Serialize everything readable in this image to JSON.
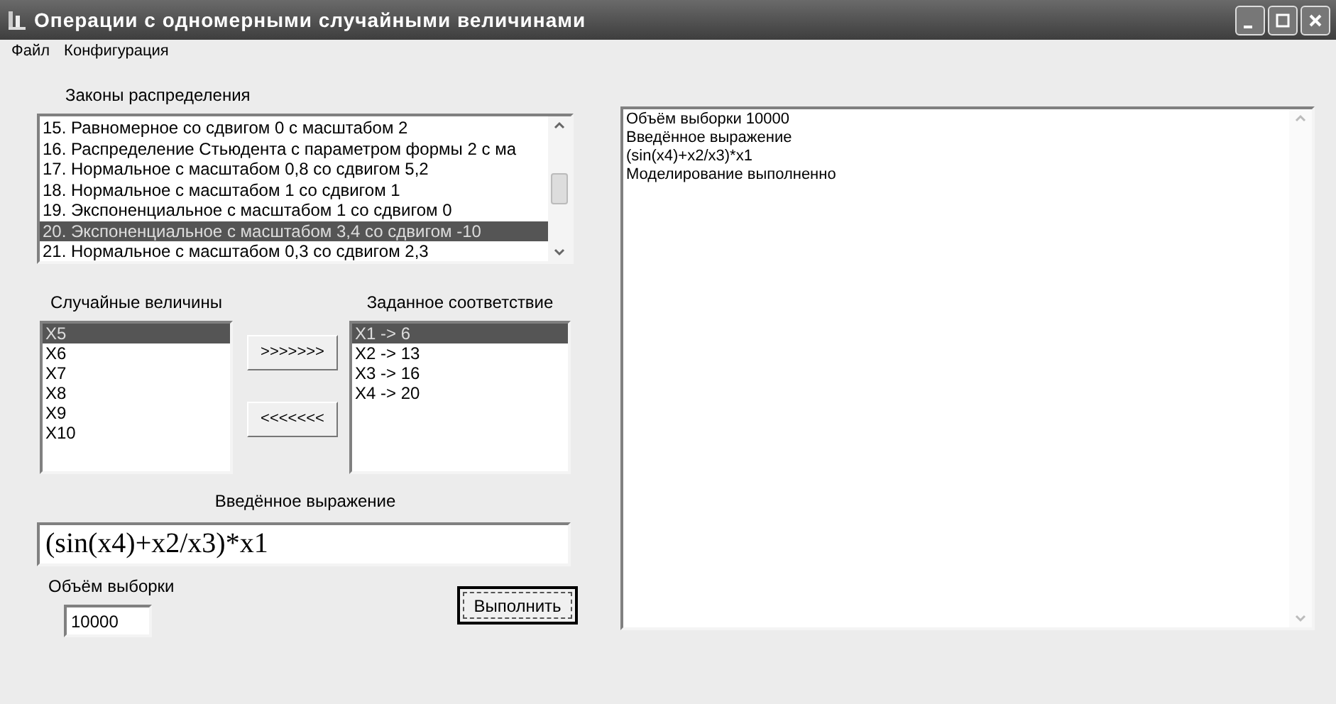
{
  "window": {
    "title": "Операции с одномерными случайными величинами"
  },
  "menu": [
    "Файл",
    "Конфигурация"
  ],
  "distributions": {
    "label": "Законы распределения",
    "items": [
      {
        "text": "15. Равномерное со сдвигом 0 с масштабом 2",
        "selected": false
      },
      {
        "text": "16. Распределение Стьюдента с параметром формы 2 с ма",
        "selected": false
      },
      {
        "text": "17. Нормальное с масштабом 0,8 со сдвигом 5,2",
        "selected": false
      },
      {
        "text": "18. Нормальное с масштабом 1 со сдвигом 1",
        "selected": false
      },
      {
        "text": "19. Экспоненциальное с масштабом 1 со сдвигом 0",
        "selected": false
      },
      {
        "text": "20. Экспоненциальное с масштабом 3,4 со сдвигом -10",
        "selected": true
      },
      {
        "text": "21. Нормальное с масштабом 0,3 со сдвигом 2,3",
        "selected": false
      }
    ]
  },
  "variables": {
    "label": "Случайные величины",
    "items": [
      {
        "text": "X5",
        "selected": true
      },
      {
        "text": "X6",
        "selected": false
      },
      {
        "text": "X7",
        "selected": false
      },
      {
        "text": "X8",
        "selected": false
      },
      {
        "text": "X9",
        "selected": false
      },
      {
        "text": "X10",
        "selected": false
      }
    ]
  },
  "add_button": ">>>>>>>",
  "remove_button": "<<<<<<<",
  "mapping": {
    "label": "Заданное соответствие",
    "items": [
      {
        "text": "X1 -> 6",
        "selected": true
      },
      {
        "text": "X2 -> 13",
        "selected": false
      },
      {
        "text": "X3 -> 16",
        "selected": false
      },
      {
        "text": "X4 -> 20",
        "selected": false
      }
    ]
  },
  "expression": {
    "label": "Введённое выражение",
    "value": "(sin(x4)+x2/x3)*x1"
  },
  "sample_size": {
    "label": "Объём выборки",
    "value": "10000"
  },
  "run_button": "Выполнить",
  "output": [
    "Объём выборки 10000",
    "Введённое выражение",
    "(sin(x4)+x2/x3)*x1",
    "Моделирование выполненно"
  ]
}
